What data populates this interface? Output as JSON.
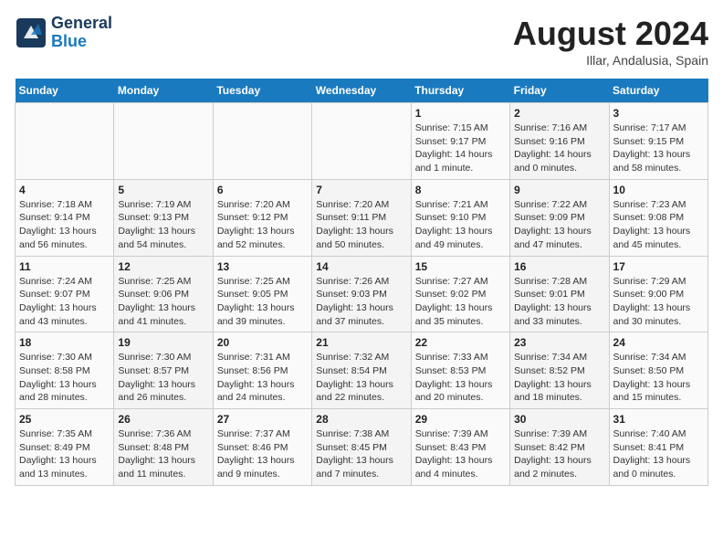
{
  "header": {
    "logo_line1": "General",
    "logo_line2": "Blue",
    "month_title": "August 2024",
    "subtitle": "Illar, Andalusia, Spain"
  },
  "weekdays": [
    "Sunday",
    "Monday",
    "Tuesday",
    "Wednesday",
    "Thursday",
    "Friday",
    "Saturday"
  ],
  "weeks": [
    [
      {
        "day": "",
        "info": ""
      },
      {
        "day": "",
        "info": ""
      },
      {
        "day": "",
        "info": ""
      },
      {
        "day": "",
        "info": ""
      },
      {
        "day": "1",
        "info": "Sunrise: 7:15 AM\nSunset: 9:17 PM\nDaylight: 14 hours\nand 1 minute."
      },
      {
        "day": "2",
        "info": "Sunrise: 7:16 AM\nSunset: 9:16 PM\nDaylight: 14 hours\nand 0 minutes."
      },
      {
        "day": "3",
        "info": "Sunrise: 7:17 AM\nSunset: 9:15 PM\nDaylight: 13 hours\nand 58 minutes."
      }
    ],
    [
      {
        "day": "4",
        "info": "Sunrise: 7:18 AM\nSunset: 9:14 PM\nDaylight: 13 hours\nand 56 minutes."
      },
      {
        "day": "5",
        "info": "Sunrise: 7:19 AM\nSunset: 9:13 PM\nDaylight: 13 hours\nand 54 minutes."
      },
      {
        "day": "6",
        "info": "Sunrise: 7:20 AM\nSunset: 9:12 PM\nDaylight: 13 hours\nand 52 minutes."
      },
      {
        "day": "7",
        "info": "Sunrise: 7:20 AM\nSunset: 9:11 PM\nDaylight: 13 hours\nand 50 minutes."
      },
      {
        "day": "8",
        "info": "Sunrise: 7:21 AM\nSunset: 9:10 PM\nDaylight: 13 hours\nand 49 minutes."
      },
      {
        "day": "9",
        "info": "Sunrise: 7:22 AM\nSunset: 9:09 PM\nDaylight: 13 hours\nand 47 minutes."
      },
      {
        "day": "10",
        "info": "Sunrise: 7:23 AM\nSunset: 9:08 PM\nDaylight: 13 hours\nand 45 minutes."
      }
    ],
    [
      {
        "day": "11",
        "info": "Sunrise: 7:24 AM\nSunset: 9:07 PM\nDaylight: 13 hours\nand 43 minutes."
      },
      {
        "day": "12",
        "info": "Sunrise: 7:25 AM\nSunset: 9:06 PM\nDaylight: 13 hours\nand 41 minutes."
      },
      {
        "day": "13",
        "info": "Sunrise: 7:25 AM\nSunset: 9:05 PM\nDaylight: 13 hours\nand 39 minutes."
      },
      {
        "day": "14",
        "info": "Sunrise: 7:26 AM\nSunset: 9:03 PM\nDaylight: 13 hours\nand 37 minutes."
      },
      {
        "day": "15",
        "info": "Sunrise: 7:27 AM\nSunset: 9:02 PM\nDaylight: 13 hours\nand 35 minutes."
      },
      {
        "day": "16",
        "info": "Sunrise: 7:28 AM\nSunset: 9:01 PM\nDaylight: 13 hours\nand 33 minutes."
      },
      {
        "day": "17",
        "info": "Sunrise: 7:29 AM\nSunset: 9:00 PM\nDaylight: 13 hours\nand 30 minutes."
      }
    ],
    [
      {
        "day": "18",
        "info": "Sunrise: 7:30 AM\nSunset: 8:58 PM\nDaylight: 13 hours\nand 28 minutes."
      },
      {
        "day": "19",
        "info": "Sunrise: 7:30 AM\nSunset: 8:57 PM\nDaylight: 13 hours\nand 26 minutes."
      },
      {
        "day": "20",
        "info": "Sunrise: 7:31 AM\nSunset: 8:56 PM\nDaylight: 13 hours\nand 24 minutes."
      },
      {
        "day": "21",
        "info": "Sunrise: 7:32 AM\nSunset: 8:54 PM\nDaylight: 13 hours\nand 22 minutes."
      },
      {
        "day": "22",
        "info": "Sunrise: 7:33 AM\nSunset: 8:53 PM\nDaylight: 13 hours\nand 20 minutes."
      },
      {
        "day": "23",
        "info": "Sunrise: 7:34 AM\nSunset: 8:52 PM\nDaylight: 13 hours\nand 18 minutes."
      },
      {
        "day": "24",
        "info": "Sunrise: 7:34 AM\nSunset: 8:50 PM\nDaylight: 13 hours\nand 15 minutes."
      }
    ],
    [
      {
        "day": "25",
        "info": "Sunrise: 7:35 AM\nSunset: 8:49 PM\nDaylight: 13 hours\nand 13 minutes."
      },
      {
        "day": "26",
        "info": "Sunrise: 7:36 AM\nSunset: 8:48 PM\nDaylight: 13 hours\nand 11 minutes."
      },
      {
        "day": "27",
        "info": "Sunrise: 7:37 AM\nSunset: 8:46 PM\nDaylight: 13 hours\nand 9 minutes."
      },
      {
        "day": "28",
        "info": "Sunrise: 7:38 AM\nSunset: 8:45 PM\nDaylight: 13 hours\nand 7 minutes."
      },
      {
        "day": "29",
        "info": "Sunrise: 7:39 AM\nSunset: 8:43 PM\nDaylight: 13 hours\nand 4 minutes."
      },
      {
        "day": "30",
        "info": "Sunrise: 7:39 AM\nSunset: 8:42 PM\nDaylight: 13 hours\nand 2 minutes."
      },
      {
        "day": "31",
        "info": "Sunrise: 7:40 AM\nSunset: 8:41 PM\nDaylight: 13 hours\nand 0 minutes."
      }
    ]
  ]
}
